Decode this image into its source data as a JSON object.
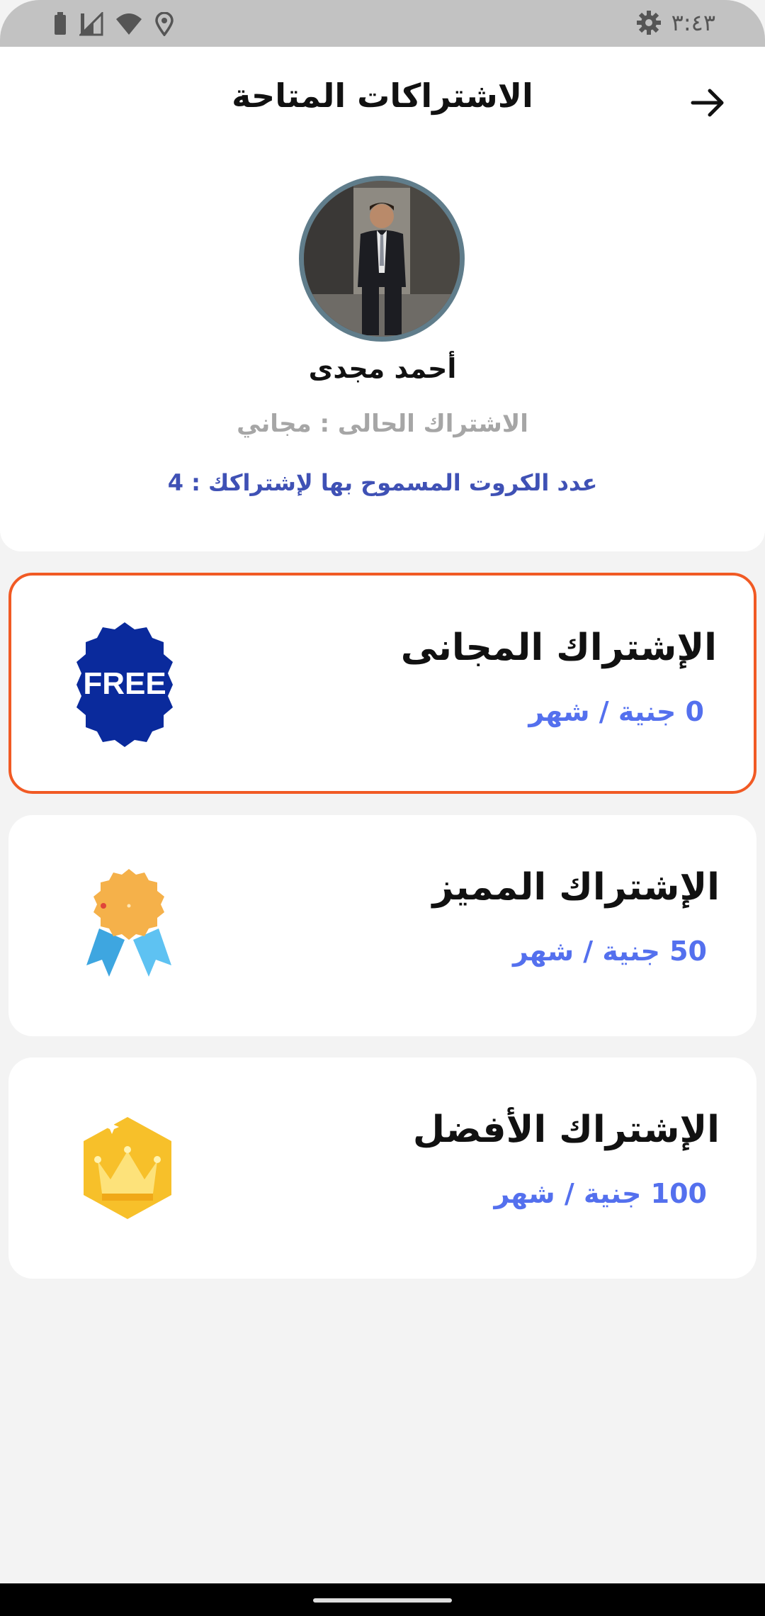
{
  "status_bar": {
    "time": "٣:٤٣",
    "icons": [
      "battery-icon",
      "signal-icon",
      "wifi-icon",
      "location-icon",
      "settings-icon"
    ]
  },
  "header": {
    "title": "الاشتراكات المتاحة",
    "back_icon": "arrow-right-icon"
  },
  "profile": {
    "name": "أحمد مجدى",
    "current_subscription": "الاشتراك الحالى :  مجاني",
    "allowed_cards": "عدد الكروت المسموح بها لإشتراكك :  4"
  },
  "plans": [
    {
      "title": "الإشتراك المجانى",
      "price": "0 جنية / شهر",
      "icon": "free-badge-icon",
      "badge_text": "FREE",
      "selected": true
    },
    {
      "title": "الإشتراك المميز",
      "price": "50 جنية / شهر",
      "icon": "award-medal-icon",
      "selected": false
    },
    {
      "title": "الإشتراك الأفضل",
      "price": "100 جنية / شهر",
      "icon": "crown-hexagon-icon",
      "selected": false
    }
  ],
  "colors": {
    "accent_selected_border": "#f15a24",
    "price_blue": "#5470ee",
    "allowed_cards_blue": "#3f51b5",
    "free_badge": "#0a2a9c"
  }
}
